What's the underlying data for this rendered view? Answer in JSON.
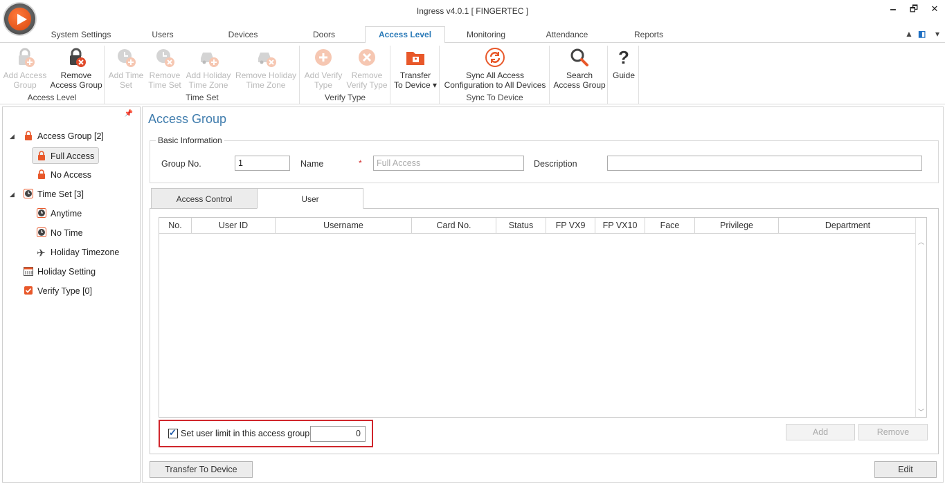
{
  "window": {
    "title": "Ingress v4.0.1 [ FINGERTEC ]",
    "minimize": "🗕",
    "restore": "🗗",
    "close": "✕"
  },
  "ribbon_tabs": [
    {
      "label": "System Settings"
    },
    {
      "label": "Users"
    },
    {
      "label": "Devices"
    },
    {
      "label": "Doors"
    },
    {
      "label": "Access Level",
      "active": true
    },
    {
      "label": "Monitoring"
    },
    {
      "label": "Attendance"
    },
    {
      "label": "Reports"
    }
  ],
  "tabs_right": {
    "collapse": "▲",
    "office": "◧",
    "dropdown": "▾"
  },
  "ribbon": {
    "groups": {
      "access_level": "Access Level",
      "time_set": "Time Set",
      "verify_type": "Verify Type",
      "sync_to_device": "Sync To Device"
    },
    "buttons": {
      "add_access_group": {
        "l1": "Add Access",
        "l2": "Group"
      },
      "remove_access_group": {
        "l1": "Remove",
        "l2": "Access Group"
      },
      "add_time_set": {
        "l1": "Add Time",
        "l2": "Set"
      },
      "remove_time_set": {
        "l1": "Remove",
        "l2": "Time Set"
      },
      "add_holiday_tz": {
        "l1": "Add Holiday",
        "l2": "Time Zone"
      },
      "remove_holiday_tz": {
        "l1": "Remove Holiday",
        "l2": "Time Zone"
      },
      "add_verify_type": {
        "l1": "Add Verify",
        "l2": "Type"
      },
      "remove_verify_type": {
        "l1": "Remove",
        "l2": "Verify Type"
      },
      "transfer": {
        "l1": "Transfer",
        "l2": "To Device ▾"
      },
      "sync_all": {
        "l1": "Sync All Access",
        "l2": "Configuration to All Devices"
      },
      "search": {
        "l1": "Search",
        "l2": "Access Group"
      },
      "guide": {
        "l1": "Guide"
      }
    }
  },
  "tree": {
    "pin": "📌",
    "items": [
      {
        "label": "Access Group [2]"
      },
      {
        "label": "Full Access"
      },
      {
        "label": "No Access"
      },
      {
        "label": "Time Set [3]"
      },
      {
        "label": "Anytime"
      },
      {
        "label": "No Time"
      },
      {
        "label": "Holiday Timezone"
      },
      {
        "label": "Holiday Setting"
      },
      {
        "label": "Verify Type [0]"
      }
    ]
  },
  "main": {
    "title": "Access Group",
    "basic_info": "Basic Information",
    "group_no_label": "Group No.",
    "group_no_value": "1",
    "name_label": "Name",
    "name_required": "*",
    "name_placeholder": "Full Access",
    "description_label": "Description",
    "description_value": "",
    "tabs": {
      "access_control": "Access Control",
      "user": "User"
    },
    "columns": [
      "No.",
      "User ID",
      "Username",
      "Card No.",
      "Status",
      "FP VX9",
      "FP VX10",
      "Face",
      "Privilege",
      "Department"
    ],
    "limit_checked": true,
    "limit_label": "Set user limit in this access group",
    "limit_value": "0",
    "add_button": "Add",
    "remove_button": "Remove",
    "transfer_button": "Transfer To Device",
    "edit_button": "Edit"
  },
  "colors": {
    "accent": "#2a7ab8",
    "icon_orange": "#e8582a",
    "highlight_red": "#d0262c"
  }
}
